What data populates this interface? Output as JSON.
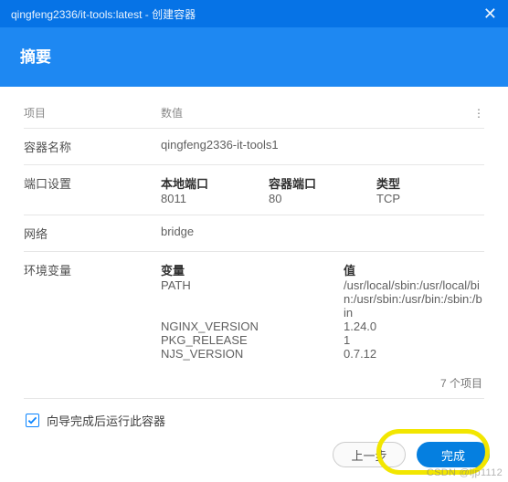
{
  "dialog": {
    "title": "qingfeng2336/it-tools:latest - 创建容器",
    "header": "摘要"
  },
  "table": {
    "col_key": "项目",
    "col_val": "数值",
    "rows": {
      "container_name": {
        "k": "容器名称",
        "v": "qingfeng2336-it-tools1"
      },
      "port": {
        "k": "端口设置",
        "h_local": "本地端口",
        "h_container": "容器端口",
        "h_type": "类型",
        "local": "8011",
        "container": "80",
        "type": "TCP"
      },
      "network": {
        "k": "网络",
        "v": "bridge"
      },
      "env": {
        "k": "环境变量",
        "h_var": "变量",
        "h_val": "值",
        "items": [
          {
            "var": "PATH",
            "val": "/usr/local/sbin:/usr/local/bin:/usr/sbin:/usr/bin:/sbin:/bin"
          },
          {
            "var": "NGINX_VERSION",
            "val": "1.24.0"
          },
          {
            "var": "PKG_RELEASE",
            "val": "1"
          },
          {
            "var": "NJS_VERSION",
            "val": "0.7.12"
          }
        ]
      }
    },
    "count_label": "7 个项目"
  },
  "run_after": {
    "label": "向导完成后运行此容器",
    "checked": true
  },
  "buttons": {
    "back": "上一步",
    "finish": "完成"
  },
  "watermark": "CSDN @ljp1112"
}
